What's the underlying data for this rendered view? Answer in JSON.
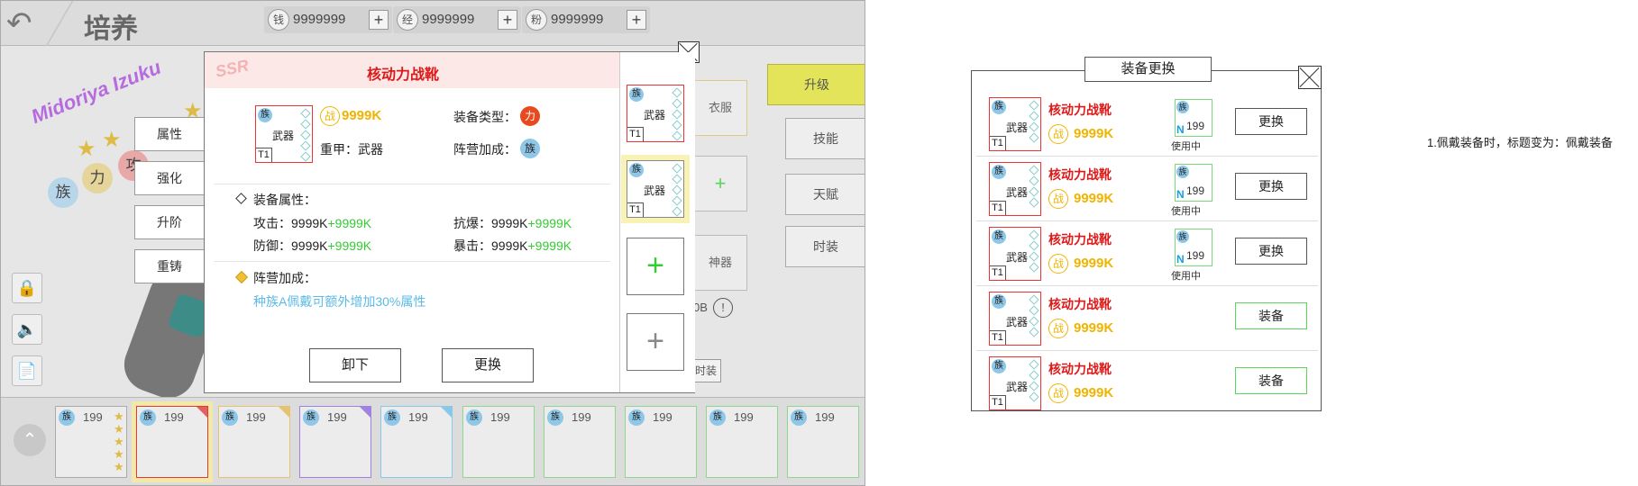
{
  "header": {
    "title": "培养",
    "back_icon": "back-arrow-icon"
  },
  "resources": [
    {
      "icon": "钱",
      "value": "9999999",
      "add": "+"
    },
    {
      "icon": "经",
      "value": "9999999",
      "add": "+"
    },
    {
      "icon": "粉",
      "value": "9999999",
      "add": "+"
    }
  ],
  "hero": {
    "name": "Midoriya Izuku",
    "tags": [
      "族",
      "力",
      "攻"
    ],
    "stars": 3
  },
  "side_menu": [
    "属性",
    "强化",
    "升阶",
    "重铸"
  ],
  "right_tabs": {
    "upgrade": "升级",
    "skills": "技能",
    "talent": "天赋",
    "fashion": "时装"
  },
  "slots": {
    "clothes": "衣服",
    "artifact": "神器",
    "partial_value": "0B",
    "partial_btn": "时装"
  },
  "popup": {
    "rarity": "SSR",
    "title": "核动力战靴",
    "item": {
      "tribe": "族",
      "name": "武器",
      "tier": "T1"
    },
    "power_icon": "战",
    "power": "9999K",
    "equip_type_label": "装备类型：",
    "equip_type_badge": "力",
    "armor_text": "重甲：武器",
    "faction_label": "阵营加成：",
    "faction_badge": "族",
    "attr_section": "装备属性：",
    "attrs": [
      {
        "label": "攻击：",
        "value": "9999K",
        "bonus": "+9999K"
      },
      {
        "label": "抗爆：",
        "value": "9999K",
        "bonus": "+9999K"
      },
      {
        "label": "防御：",
        "value": "9999K",
        "bonus": "+9999K"
      },
      {
        "label": "暴击：",
        "value": "9999K",
        "bonus": "+9999K"
      }
    ],
    "faction_section": "阵营加成：",
    "faction_desc": "种族A佩戴可额外增加30%属性",
    "unequip": "卸下",
    "replace": "更换"
  },
  "popup_side": {
    "items": [
      {
        "tribe": "族",
        "name": "武器",
        "tier": "T1"
      },
      {
        "tribe": "族",
        "name": "武器",
        "tier": "T1"
      }
    ],
    "add_green": "+",
    "add_gray": "+"
  },
  "bottom_cards": [
    {
      "tribe": "族",
      "level": "199"
    },
    {
      "tribe": "族",
      "level": "199"
    },
    {
      "tribe": "族",
      "level": "199"
    },
    {
      "tribe": "族",
      "level": "199"
    },
    {
      "tribe": "族",
      "level": "199"
    },
    {
      "tribe": "族",
      "level": "199"
    },
    {
      "tribe": "族",
      "level": "199"
    },
    {
      "tribe": "族",
      "level": "199"
    },
    {
      "tribe": "族",
      "level": "199"
    },
    {
      "tribe": "族",
      "level": "199"
    }
  ],
  "panel": {
    "title": "装备更换",
    "rows": [
      {
        "tribe": "族",
        "name": "武器",
        "tier": "T1",
        "item_name": "核动力战靴",
        "power_icon": "战",
        "power": "9999K",
        "hero_tribe": "族",
        "hero_n": "N",
        "hero_level": "199",
        "in_use": "使用中",
        "button": "更换"
      },
      {
        "tribe": "族",
        "name": "武器",
        "tier": "T1",
        "item_name": "核动力战靴",
        "power_icon": "战",
        "power": "9999K",
        "hero_tribe": "族",
        "hero_n": "N",
        "hero_level": "199",
        "in_use": "使用中",
        "button": "更换"
      },
      {
        "tribe": "族",
        "name": "武器",
        "tier": "T1",
        "item_name": "核动力战靴",
        "power_icon": "战",
        "power": "9999K",
        "hero_tribe": "族",
        "hero_n": "N",
        "hero_level": "199",
        "in_use": "使用中",
        "button": "更换"
      },
      {
        "tribe": "族",
        "name": "武器",
        "tier": "T1",
        "item_name": "核动力战靴",
        "power_icon": "战",
        "power": "9999K",
        "button": "装备"
      },
      {
        "tribe": "族",
        "name": "武器",
        "tier": "T1",
        "item_name": "核动力战靴",
        "power_icon": "战",
        "power": "9999K",
        "button": "装备"
      }
    ]
  },
  "note": "1.佩戴装备时，标题变为：佩戴装备",
  "colors": {
    "accent_red": "#dd1a1a",
    "power_gold": "#f0b400",
    "bonus_green": "#33cc33",
    "link_blue": "#5bbbe6",
    "upgrade_yellow": "#e4e45a"
  }
}
